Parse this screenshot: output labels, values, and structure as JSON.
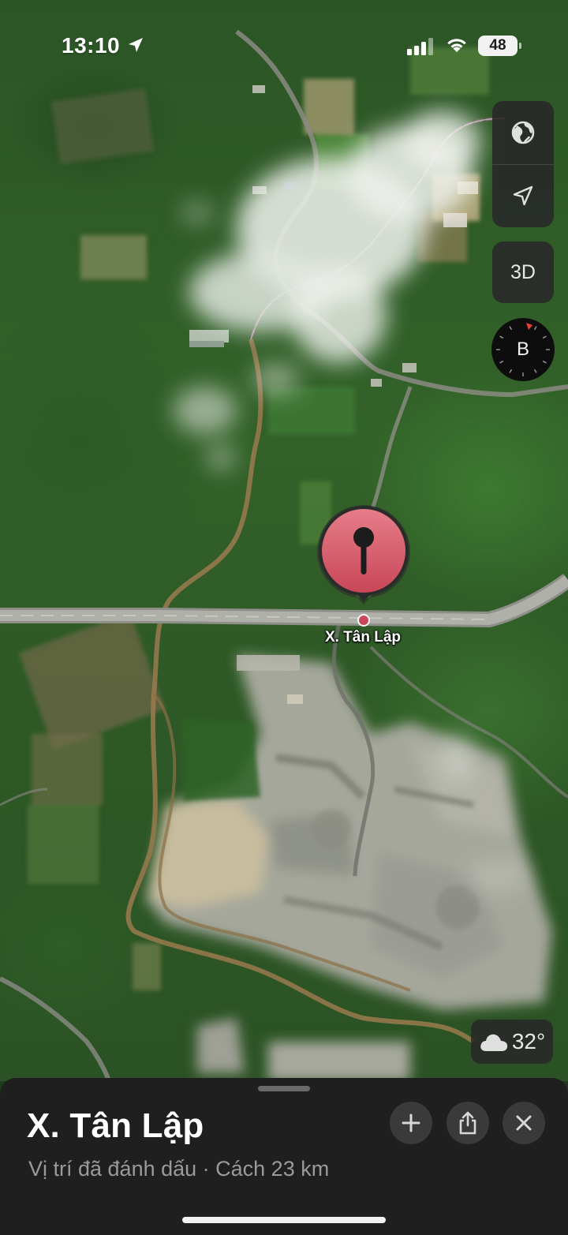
{
  "status_bar": {
    "time": "13:10",
    "battery": "48",
    "icons": [
      "location-arrow-icon",
      "signal-bars-icon",
      "wifi-icon",
      "battery-icon"
    ]
  },
  "map_controls": {
    "globe_icon": "globe-icon",
    "locate_icon": "location-arrow-icon",
    "button_3d": "3D",
    "compass_letter": "B"
  },
  "pin": {
    "label": "X. Tân Lập",
    "color": "#d65a6a"
  },
  "weather": {
    "icon": "cloud-icon",
    "temperature": "32°"
  },
  "sheet": {
    "title": "X. Tân Lập",
    "subtitle": "Vị trí đã đánh dấu · Cách 23 km",
    "buttons": [
      "plus-icon",
      "share-icon",
      "close-icon"
    ]
  },
  "colors": {
    "sheet_background": "#1f1f1f",
    "control_background": "#282828",
    "compass_north": "#e8403a"
  }
}
